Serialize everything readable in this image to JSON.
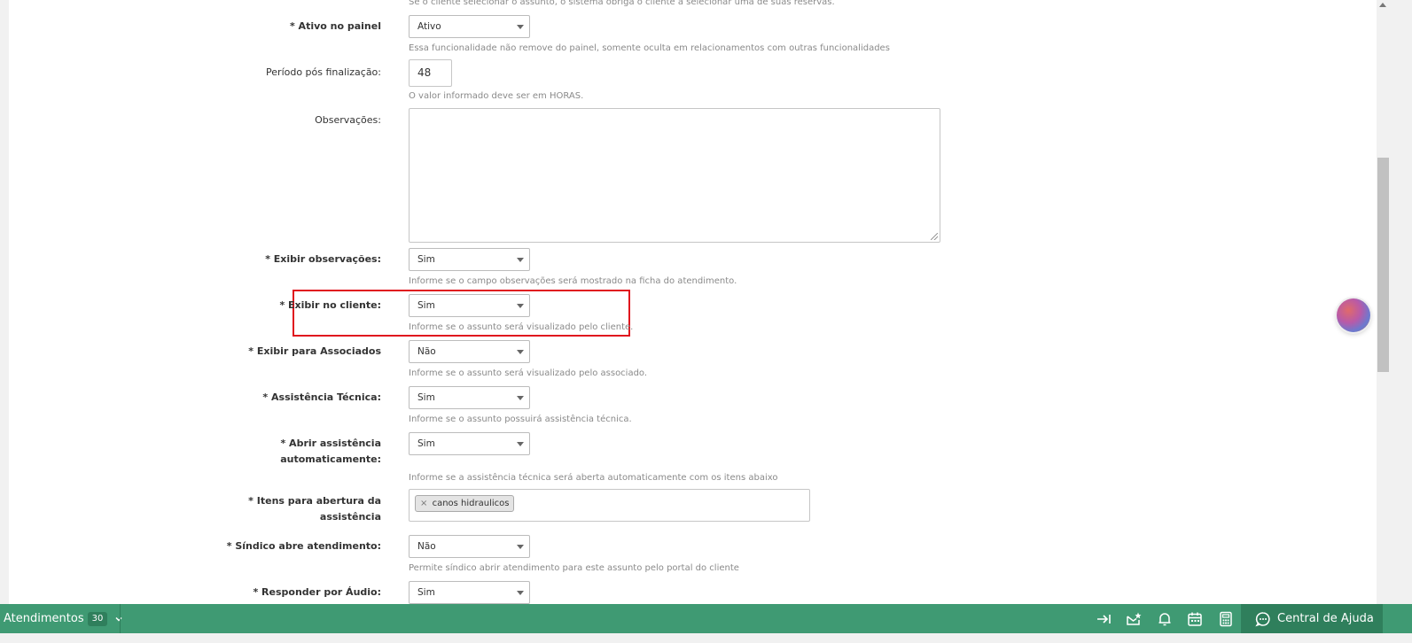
{
  "form": {
    "top_help_cut": "Se o cliente selecionar o assunto, o sistema obriga o cliente a selecionar uma de suas reservas.",
    "fields": {
      "ativo_painel": {
        "label": "* Ativo no painel",
        "value": "Ativo",
        "help": "Essa funcionalidade não remove do painel, somente oculta em relacionamentos com outras funcionalidades"
      },
      "periodo": {
        "label": "Período pós finalização:",
        "value": "48",
        "help": "O valor informado deve ser em HORAS."
      },
      "observacoes": {
        "label": "Observações:",
        "value": ""
      },
      "exibir_observacoes": {
        "label": "* Exibir observações:",
        "value": "Sim",
        "help": "Informe se o campo observações será mostrado na ficha do atendimento."
      },
      "exibir_cliente": {
        "label": "* Exibir no cliente:",
        "value": "Sim",
        "help": "Informe se o assunto será visualizado pelo cliente."
      },
      "exibir_associados": {
        "label": "* Exibir para Associados",
        "value": "Não",
        "help": "Informe se o assunto será visualizado pelo associado."
      },
      "assistencia_tecnica": {
        "label": "* Assistência Técnica:",
        "value": "Sim",
        "help": "Informe se o assunto possuirá assistência técnica."
      },
      "abrir_assistencia": {
        "label_1": "* Abrir assistência",
        "label_2": "automaticamente:",
        "value": "Sim",
        "help": "Informe se a assistência técnica será aberta automaticamente com os itens abaixo"
      },
      "itens_abertura": {
        "label_1": "* Itens para abertura da",
        "label_2": "assistência",
        "tags": [
          "canos hidraulicos"
        ],
        "remove_glyph": "×"
      },
      "sindico_abre": {
        "label": "* Síndico abre atendimento:",
        "value": "Não",
        "help": "Permite síndico abrir atendimento para este assunto pelo portal do cliente"
      },
      "responder_audio": {
        "label": "* Responder por Áudio:",
        "value": "Sim"
      }
    }
  },
  "bottom_bar": {
    "atendimentos_label": "Atendimentos",
    "atendimentos_count": "30",
    "help_label": "Central de Ajuda",
    "icons": [
      "collapse-right-icon",
      "mail-star-icon",
      "bell-icon",
      "calendar-icon",
      "calculator-icon",
      "chat-help-icon"
    ]
  },
  "colors": {
    "bottom_bar": "#3f9a73",
    "bottom_bar_dark": "#2f7f5c",
    "highlight": "#e0141e"
  }
}
